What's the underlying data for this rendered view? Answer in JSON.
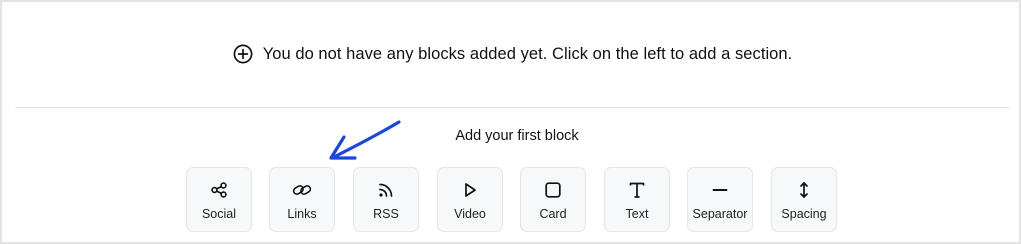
{
  "empty_state": {
    "message": "You do not have any blocks added yet. Click on the left to add a section.",
    "icon": "plus-circle-icon"
  },
  "add_block": {
    "title": "Add your first block",
    "blocks": [
      {
        "label": "Social",
        "icon": "share-icon"
      },
      {
        "label": "Links",
        "icon": "link-icon"
      },
      {
        "label": "RSS",
        "icon": "rss-icon"
      },
      {
        "label": "Video",
        "icon": "play-icon"
      },
      {
        "label": "Card",
        "icon": "card-icon"
      },
      {
        "label": "Text",
        "icon": "text-icon"
      },
      {
        "label": "Separator",
        "icon": "separator-icon"
      },
      {
        "label": "Spacing",
        "icon": "spacing-icon"
      }
    ]
  },
  "colors": {
    "accent_arrow": "#1a47d9",
    "button_bg": "#f7f8f9",
    "border": "#e4e5e7"
  }
}
